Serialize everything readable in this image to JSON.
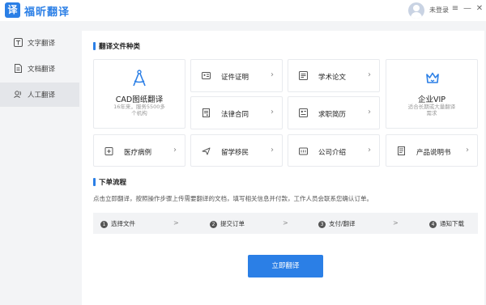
{
  "app": {
    "name": "福昕翻译",
    "logo_char": "译"
  },
  "user": {
    "login_text": "未登录"
  },
  "window": {
    "menu": "≡",
    "minimize": "—",
    "close": "✕"
  },
  "sidebar": {
    "items": [
      {
        "label": "文字翻译",
        "icon": "text-translate-icon"
      },
      {
        "label": "文档翻译",
        "icon": "document-translate-icon"
      },
      {
        "label": "人工翻译",
        "icon": "human-translate-icon",
        "active": true
      }
    ]
  },
  "categories": {
    "title": "翻译文件种类",
    "cad": {
      "title": "CAD图纸翻译",
      "sub1": "16年来，服务5500多",
      "sub2": "个机构"
    },
    "vip": {
      "title": "企业VIP",
      "sub1": "适合长期或大量翻译",
      "sub2": "需求"
    },
    "items": [
      {
        "label": "证件证明",
        "icon": "id-card-icon"
      },
      {
        "label": "学术论文",
        "icon": "paper-icon"
      },
      {
        "label": "法律合同",
        "icon": "contract-icon"
      },
      {
        "label": "求职简历",
        "icon": "resume-icon"
      },
      {
        "label": "医疗病例",
        "icon": "medical-icon"
      },
      {
        "label": "留学移民",
        "icon": "plane-icon"
      },
      {
        "label": "公司介绍",
        "icon": "company-icon"
      },
      {
        "label": "产品说明书",
        "icon": "manual-icon"
      }
    ],
    "arrow": "›"
  },
  "process": {
    "title": "下单流程",
    "description": "点击立即翻译，按照操作步骤上传需要翻译的文档，填写相关信息并付款，工作人员会联系您确认订单。",
    "steps": [
      {
        "num": "1",
        "label": "选择文件"
      },
      {
        "num": "2",
        "label": "提交订单"
      },
      {
        "num": "3",
        "label": "支付/翻译"
      },
      {
        "num": "4",
        "label": "通知下载"
      }
    ],
    "separator": ">"
  },
  "cta": {
    "label": "立即翻译"
  },
  "colors": {
    "accent": "#2b7fe6",
    "bg": "#f3f4f6"
  }
}
